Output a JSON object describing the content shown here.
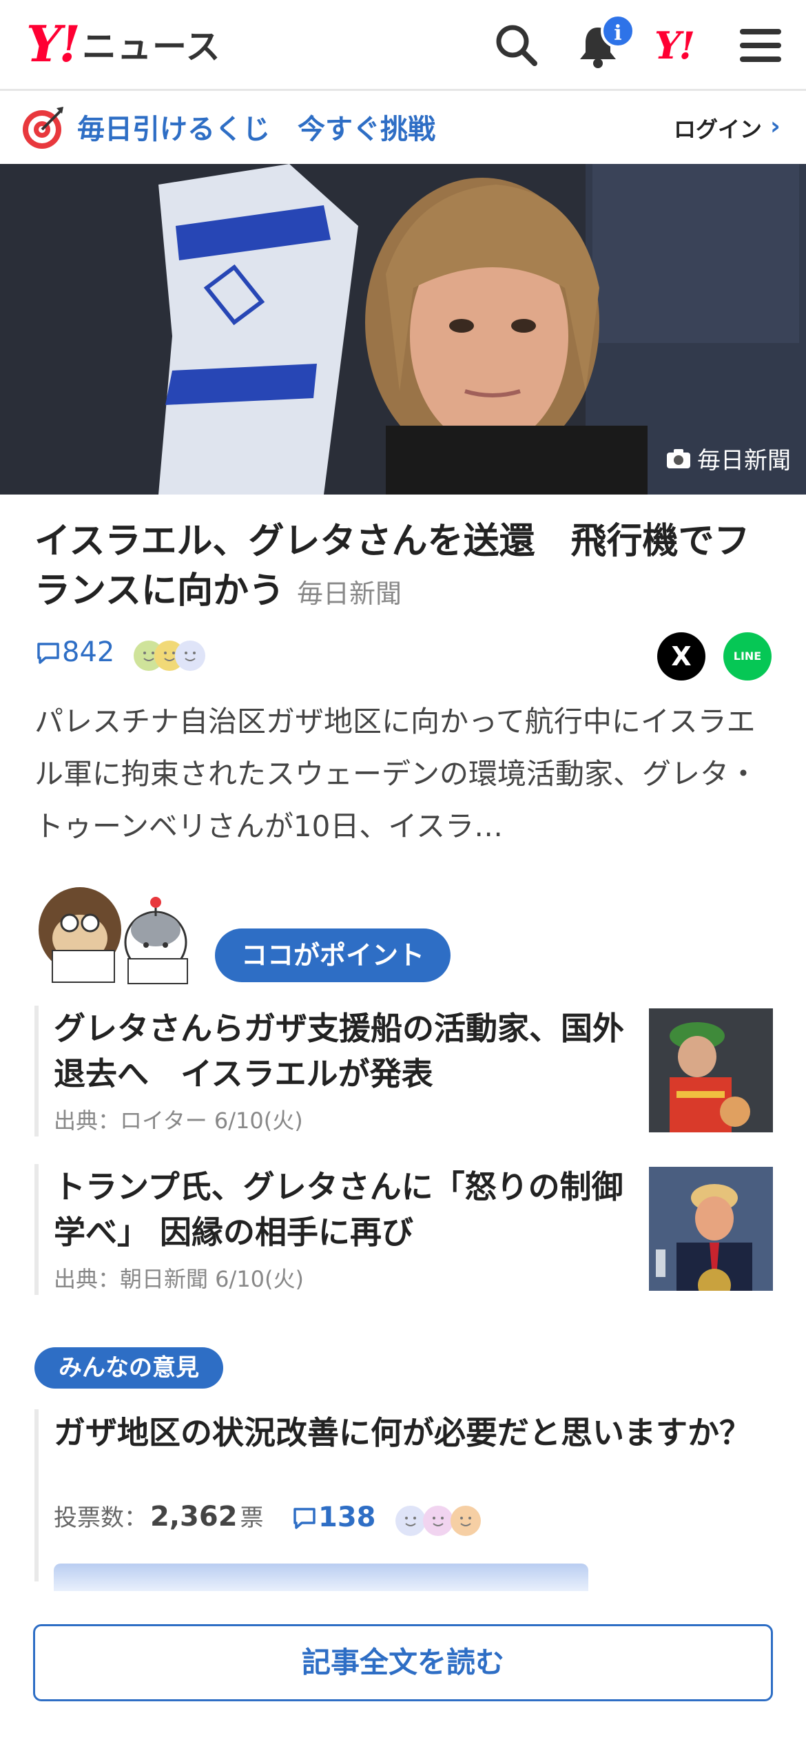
{
  "header": {
    "logo_mark": "Y!",
    "logo_text": "ニュース",
    "notification_badge": "i",
    "yahoo_mark": "Y!"
  },
  "banner": {
    "text": "毎日引けるくじ　今すぐ挑戦",
    "login_label": "ログイン"
  },
  "hero": {
    "photo_credit": "毎日新聞"
  },
  "article": {
    "title": "イスラエル、グレタさんを送還　飛行機でフランスに向かう",
    "source": "毎日新聞",
    "comment_count": "842",
    "lead": "パレスチナ自治区ガザ地区に向かって航行中にイスラエル軍に拘束されたスウェーデンの環境活動家、グレタ・トゥーンベリさんが10日、イスラ…",
    "share_x_label": "X",
    "share_line_label": "LINE"
  },
  "point": {
    "pill_label": "ココがポイント"
  },
  "related": [
    {
      "title": "グレタさんらガザ支援船の活動家、国外退去へ　イスラエルが発表",
      "source": "出典：ロイター 6/10(火)"
    },
    {
      "title": "トランプ氏、グレタさんに「怒りの制御学べ」 因縁の相手に再び",
      "source": "出典：朝日新聞 6/10(火)"
    }
  ],
  "opinion": {
    "pill_label": "みんなの意見",
    "question": "ガザ地区の状況改善に何が必要だと思いますか？",
    "votes_label": "投票数：",
    "votes_count": "2,362",
    "votes_unit": "票",
    "comment_count": "138"
  },
  "footer": {
    "read_full_label": "記事全文を読む"
  },
  "colors": {
    "brand_red": "#ff0033",
    "accent_blue": "#2e6ec5",
    "badge_blue": "#2e73e8",
    "line_green": "#06c755"
  }
}
